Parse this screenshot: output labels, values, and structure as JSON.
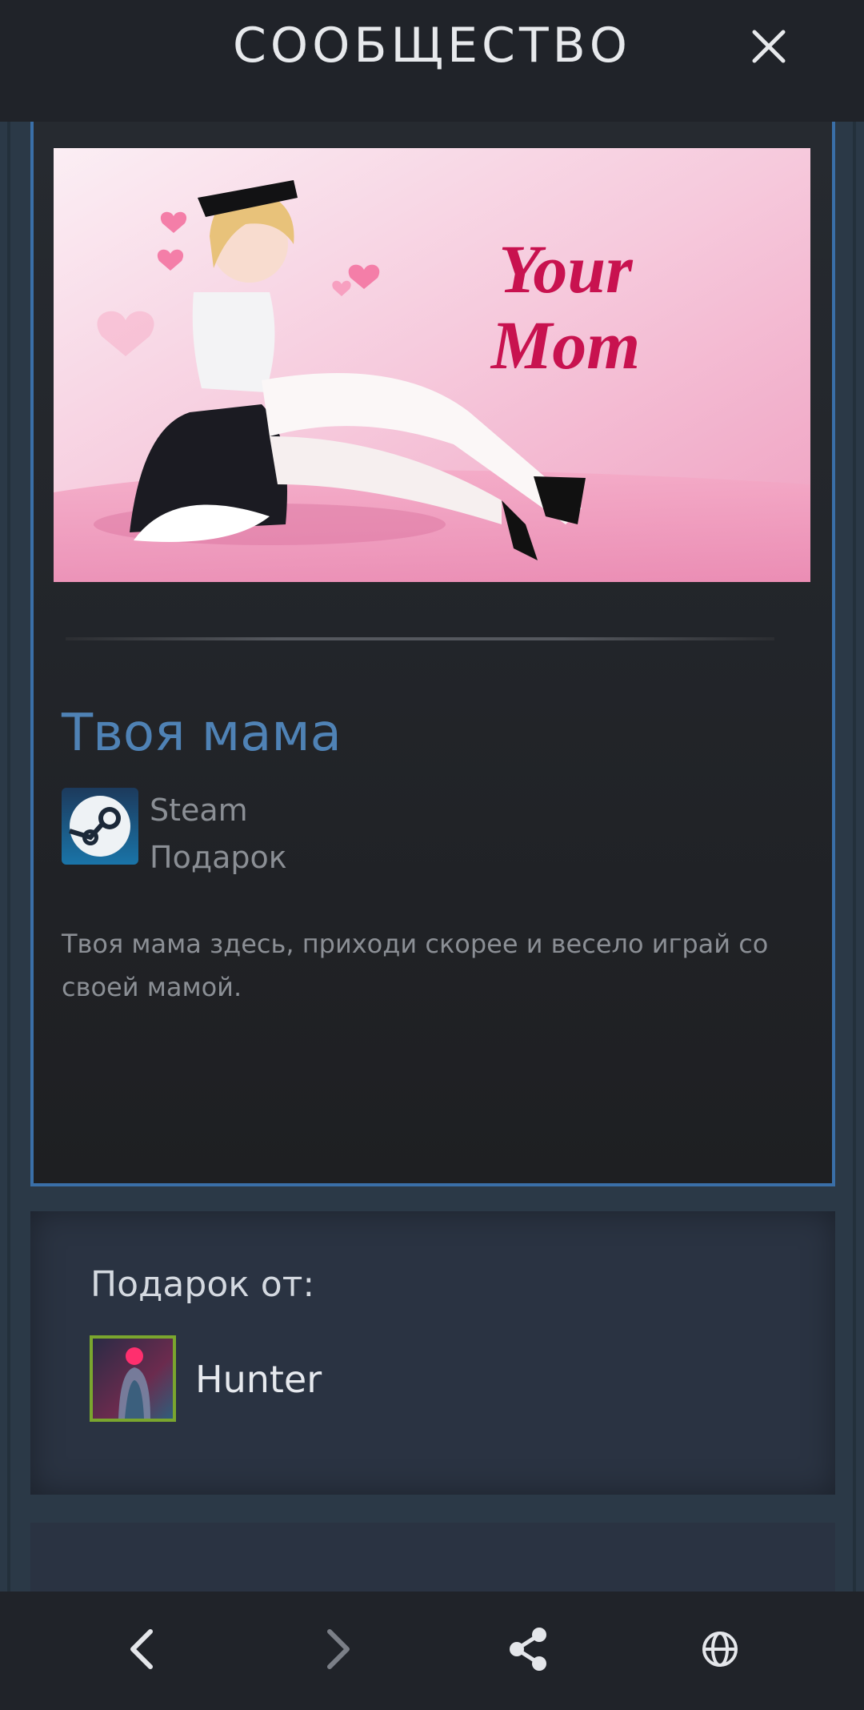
{
  "header": {
    "title": "СООБЩЕСТВО",
    "close_icon": "close-icon"
  },
  "item": {
    "banner_text_line1": "Your",
    "banner_text_line2": "Mom",
    "name": "Твоя мама",
    "app_name": "Steam",
    "type": "Подарок",
    "description": "Твоя мама здесь, приходи скорее и весело играй со своей мамой."
  },
  "gift": {
    "label": "Подарок от:",
    "user": "Hunter"
  },
  "colors": {
    "accent_blue": "#4f82b5",
    "card_border": "#3a6fa8",
    "avatar_border": "#7aa62e"
  },
  "navbar": {
    "icons": [
      "back-icon",
      "forward-icon",
      "share-icon",
      "globe-icon"
    ]
  }
}
